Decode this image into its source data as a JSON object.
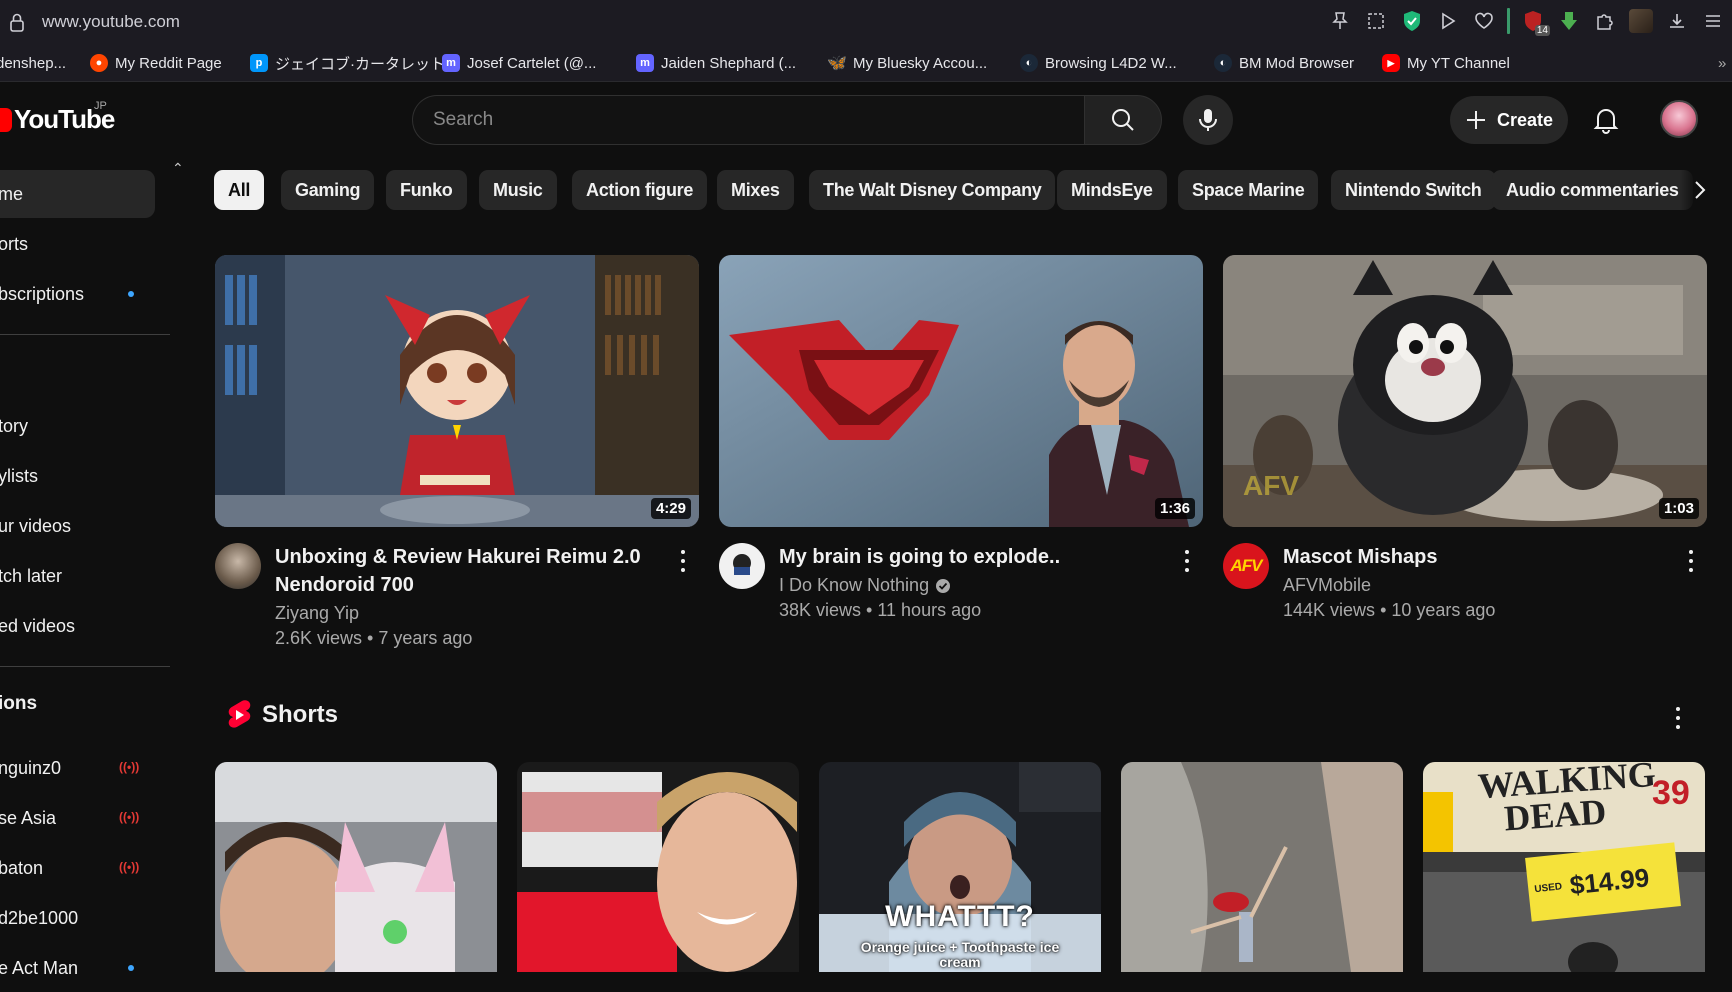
{
  "browser": {
    "url": "www.youtube.com",
    "extension_badge": "14",
    "bookmarks": [
      {
        "label": "denshep...",
        "icon": "generic-bookmark-icon"
      },
      {
        "label": "My Reddit Page",
        "icon": "reddit-icon"
      },
      {
        "label": "ジェイコブ·カータレット...",
        "icon": "pixiv-icon"
      },
      {
        "label": "Josef Cartelet (@...",
        "icon": "mastodon-icon"
      },
      {
        "label": "Jaiden Shephard (...",
        "icon": "mastodon-icon"
      },
      {
        "label": "My Bluesky Accou...",
        "icon": "bluesky-icon"
      },
      {
        "label": "Browsing L4D2 W...",
        "icon": "steam-icon"
      },
      {
        "label": "BM Mod Browser",
        "icon": "steam-icon"
      },
      {
        "label": "My YT Channel",
        "icon": "youtube-icon"
      }
    ]
  },
  "header": {
    "logo_text": "YouTube",
    "region": "JP",
    "search_placeholder": "Search",
    "create_label": "Create"
  },
  "sidebar": {
    "items": [
      {
        "label": "me",
        "active": true
      },
      {
        "label": "orts"
      },
      {
        "label": "bscriptions",
        "dot": true
      }
    ],
    "you_items": [
      {
        "label": "tory"
      },
      {
        "label": "ylists"
      },
      {
        "label": "ur videos"
      },
      {
        "label": "tch later"
      },
      {
        "label": "ed videos"
      }
    ],
    "subs_header": "ions",
    "subs": [
      {
        "label": "nguinz0",
        "live": true
      },
      {
        "label": "se Asia",
        "live": true
      },
      {
        "label": "baton",
        "live": true
      },
      {
        "label": "d2be1000"
      },
      {
        "label": "e Act Man",
        "dot": true
      }
    ]
  },
  "chips": [
    "All",
    "Gaming",
    "Funko",
    "Music",
    "Action figure",
    "Mixes",
    "The Walt Disney Company",
    "MindsEye",
    "Space Marine",
    "Nintendo Switch",
    "Audio commentaries"
  ],
  "videos": [
    {
      "title": "Unboxing & Review Hakurei Reimu 2.0 Nendoroid 700",
      "channel": "Ziyang Yip",
      "views": "2.6K views",
      "age": "7 years ago",
      "duration": "4:29",
      "verified": false
    },
    {
      "title": "My brain is going to explode..",
      "channel": "I Do Know Nothing",
      "views": "38K views",
      "age": "11 hours ago",
      "duration": "1:36",
      "verified": true
    },
    {
      "title": "Mascot Mishaps",
      "channel": "AFVMobile",
      "views": "144K views",
      "age": "10 years ago",
      "duration": "1:03",
      "verified": false,
      "channel_logo_text": "AFV"
    }
  ],
  "shorts": {
    "heading": "Shorts",
    "items": [
      {
        "caption": ""
      },
      {
        "caption": ""
      },
      {
        "caption": "WHATTT?",
        "subcaption": "Orange juice + Toothpaste ice cream"
      },
      {
        "caption": ""
      },
      {
        "caption": "",
        "overlay_title": "WALKING DEAD",
        "overlay_number": "39",
        "price": "$14.99",
        "price_label": "USED"
      }
    ]
  },
  "colors": {
    "background": "#0f0f0f",
    "chip": "#272727",
    "chip_selected": "#f1f1f1",
    "brand_red": "#ff0000",
    "secondary_text": "#aaaaaa",
    "accent_blue": "#3ea6ff"
  }
}
